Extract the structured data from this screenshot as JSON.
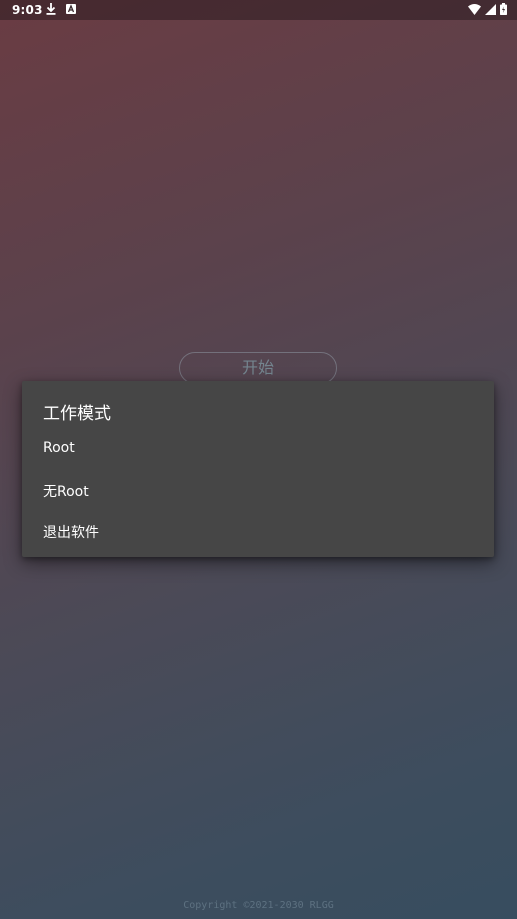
{
  "status_bar": {
    "time": "9:03",
    "left_icons": [
      "download-icon",
      "notification-a-icon"
    ],
    "right_icons": [
      "wifi-icon",
      "cell-signal-icon",
      "battery-icon"
    ]
  },
  "main": {
    "start_label": "开始"
  },
  "dialog": {
    "title": "工作模式",
    "items": [
      {
        "label": "Root"
      },
      {
        "label": "无Root"
      },
      {
        "label": "退出软件"
      }
    ]
  },
  "footer": {
    "copyright": "Copyright ©2021-2030 RLGG"
  },
  "colors": {
    "dialog_bg": "#464646",
    "gradient_top": "#6a3c43",
    "gradient_bottom": "#374d5f"
  }
}
